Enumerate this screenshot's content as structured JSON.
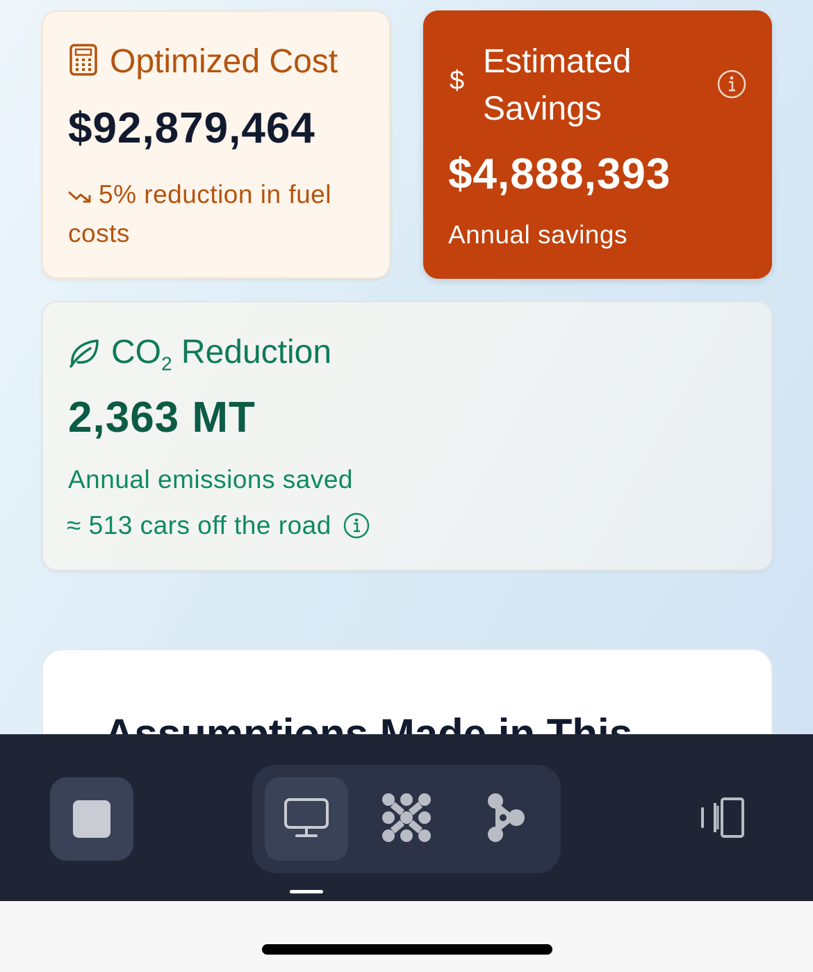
{
  "cards": {
    "cost": {
      "title": "Optimized Cost",
      "value": "$92,879,464",
      "note": "5% reduction in fuel costs",
      "icon": "calculator-icon",
      "color": "#b4540e"
    },
    "savings": {
      "currency_symbol": "$",
      "title": "Estimated Savings",
      "value": "$4,888,393",
      "note": "Annual savings",
      "icon": "info-icon",
      "color": "#c2410c"
    },
    "co2": {
      "title_prefix": "CO",
      "title_subscript": "2",
      "title_suffix": " Reduction",
      "value": "2,363 MT",
      "note": "Annual emissions saved",
      "cars": "≈ 513 cars off the road",
      "icon": "leaf-icon",
      "color": "#0f7a5a"
    },
    "assumptions": {
      "title": "Assumptions Made in This"
    }
  },
  "toolbar": {
    "stop_icon": "stop-icon",
    "modes": [
      "monitor-icon",
      "dots-grid-icon",
      "share-nodes-icon"
    ],
    "active_mode": "monitor-icon",
    "rotate_icon": "rotate-device-icon"
  }
}
